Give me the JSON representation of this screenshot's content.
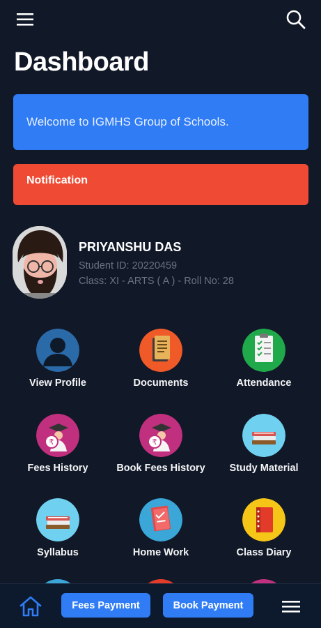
{
  "header": {
    "menu_icon": "hamburger-menu-icon",
    "search_icon": "search-icon",
    "title": "Dashboard"
  },
  "welcome": {
    "text": "Welcome to IGMHS Group of Schools."
  },
  "notification": {
    "label": "Notification"
  },
  "student": {
    "name": "PRIYANSHU DAS",
    "id_line": "Student ID: 20220459",
    "class_line": "Class: XI - ARTS ( A ) - Roll No: 28"
  },
  "menu": [
    {
      "label": "View Profile",
      "icon": "profile-icon"
    },
    {
      "label": "Documents",
      "icon": "documents-icon"
    },
    {
      "label": "Attendance",
      "icon": "attendance-icon"
    },
    {
      "label": "Fees History",
      "icon": "fees-history-icon"
    },
    {
      "label": "Book Fees History",
      "icon": "book-fees-history-icon"
    },
    {
      "label": "Study Material",
      "icon": "study-material-icon"
    },
    {
      "label": "Syllabus",
      "icon": "syllabus-icon"
    },
    {
      "label": "Home Work",
      "icon": "home-work-icon"
    },
    {
      "label": "Class Diary",
      "icon": "class-diary-icon"
    }
  ],
  "bottom_nav": {
    "home_icon": "home-icon",
    "fees_payment": "Fees Payment",
    "book_payment": "Book Payment",
    "more_icon": "hamburger-menu-icon"
  },
  "colors": {
    "background": "#111827",
    "accent_blue": "#2f7cf5",
    "notification_red": "#ef4b34"
  }
}
